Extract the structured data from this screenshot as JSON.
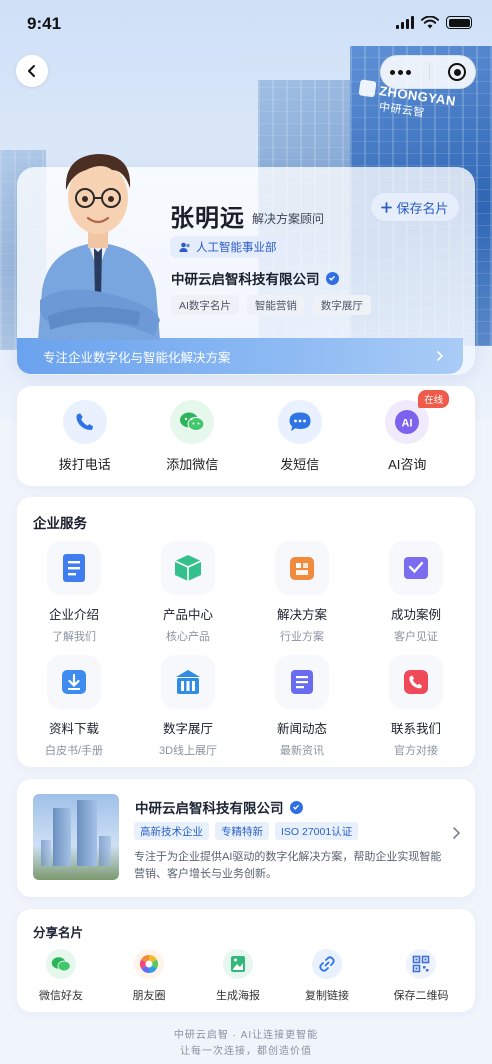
{
  "status_bar": {
    "time": "9:41"
  },
  "hero": {
    "building_logo_en": "ZHONGYAN",
    "building_logo_cn": "中研云智"
  },
  "profile": {
    "name": "张明远",
    "role": "解决方案顾问",
    "save_label": "保存名片",
    "department": "人工智能事业部",
    "company": "中研云启智科技有限公司",
    "tags": [
      "AI数字名片",
      "智能营销",
      "数字展厅"
    ],
    "tagline": "专注企业数字化与智能化解决方案"
  },
  "contact": {
    "items": [
      {
        "label": "拨打电话",
        "icon": "phone-icon"
      },
      {
        "label": "添加微信",
        "icon": "wechat-icon"
      },
      {
        "label": "发短信",
        "icon": "message-icon"
      },
      {
        "label": "AI咨询",
        "icon": "ai-icon",
        "badge": "在线"
      }
    ]
  },
  "services": {
    "title": "企业服务",
    "items": [
      {
        "title": "企业介绍",
        "sub": "了解我们",
        "icon": "document-icon",
        "color": "#3f7df0"
      },
      {
        "title": "产品中心",
        "sub": "核心产品",
        "icon": "box-icon",
        "color": "#34c08a"
      },
      {
        "title": "解决方案",
        "sub": "行业方案",
        "icon": "layers-icon",
        "color": "#f08a3c"
      },
      {
        "title": "成功案例",
        "sub": "客户见证",
        "icon": "case-icon",
        "color": "#7b6cf0"
      },
      {
        "title": "资料下载",
        "sub": "白皮书/手册",
        "icon": "download-icon",
        "color": "#3f8cf0"
      },
      {
        "title": "数字展厅",
        "sub": "3D线上展厅",
        "icon": "hall-icon",
        "color": "#2f8de4"
      },
      {
        "title": "新闻动态",
        "sub": "最新资讯",
        "icon": "news-icon",
        "color": "#6a6cf0"
      },
      {
        "title": "联系我们",
        "sub": "官方对接",
        "icon": "contact-phone-icon",
        "color": "#f04a5a"
      }
    ]
  },
  "company_card": {
    "name": "中研云启智科技有限公司",
    "tags": [
      "高新技术企业",
      "专精特新",
      "ISO 27001认证"
    ],
    "description": "专注于为企业提供AI驱动的数字化解决方案，帮助企业实现智能营销、客户增长与业务创新。"
  },
  "share": {
    "title": "分享名片",
    "items": [
      {
        "label": "微信好友",
        "icon": "wechat-icon"
      },
      {
        "label": "朋友圈",
        "icon": "moments-icon"
      },
      {
        "label": "生成海报",
        "icon": "poster-icon"
      },
      {
        "label": "复制链接",
        "icon": "link-icon"
      },
      {
        "label": "保存二维码",
        "icon": "qrcode-icon"
      }
    ]
  },
  "footer": {
    "line1": "中研云启智 · AI让连接更智能",
    "line2": "让每一次连接，都创造价值"
  }
}
